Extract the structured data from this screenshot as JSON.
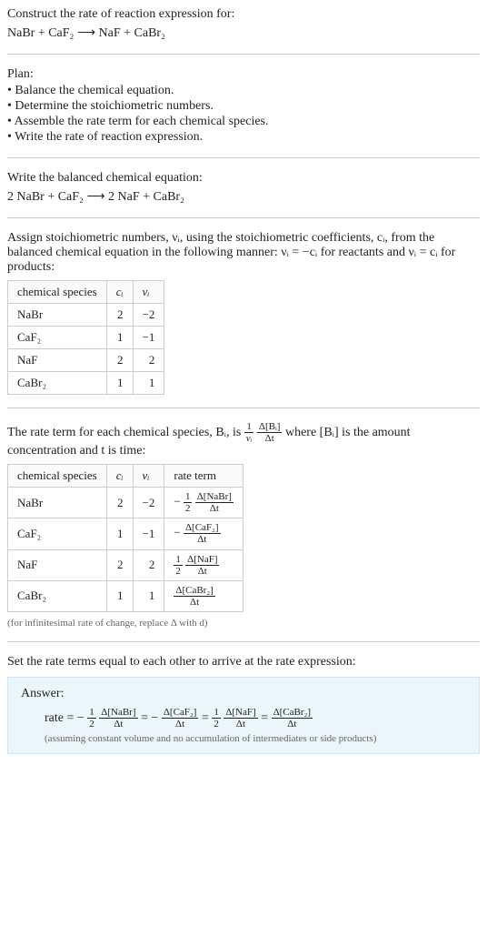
{
  "header": {
    "construct": "Construct the rate of reaction expression for:",
    "unbalanced": "NaBr + CaF₂ ⟶ NaF + CaBr₂"
  },
  "plan": {
    "title": "Plan:",
    "items": [
      "• Balance the chemical equation.",
      "• Determine the stoichiometric numbers.",
      "• Assemble the rate term for each chemical species.",
      "• Write the rate of reaction expression."
    ]
  },
  "balanced": {
    "text": "Write the balanced chemical equation:",
    "eq": "2 NaBr + CaF₂ ⟶ 2 NaF + CaBr₂"
  },
  "stoich_text": "Assign stoichiometric numbers, νᵢ, using the stoichiometric coefficients, cᵢ, from the balanced chemical equation in the following manner: νᵢ = −cᵢ for reactants and νᵢ = cᵢ for products:",
  "table1": {
    "headers": [
      "chemical species",
      "cᵢ",
      "νᵢ"
    ],
    "rows": [
      {
        "species": "NaBr",
        "c": "2",
        "v": "−2"
      },
      {
        "species": "CaF₂",
        "c": "1",
        "v": "−1"
      },
      {
        "species": "NaF",
        "c": "2",
        "v": "2"
      },
      {
        "species": "CaBr₂",
        "c": "1",
        "v": "1"
      }
    ]
  },
  "rate_term_text_1": "The rate term for each chemical species, Bᵢ, is ",
  "rate_term_text_2": " where [Bᵢ] is the amount concentration and t is time:",
  "rate_term_frac": {
    "num1": "1",
    "den1": "νᵢ",
    "num2": "Δ[Bᵢ]",
    "den2": "Δt"
  },
  "table2": {
    "headers": [
      "chemical species",
      "cᵢ",
      "νᵢ",
      "rate term"
    ],
    "rows": [
      {
        "species": "NaBr",
        "c": "2",
        "v": "−2",
        "rt": {
          "pre": "−",
          "f1n": "1",
          "f1d": "2",
          "f2n": "Δ[NaBr]",
          "f2d": "Δt"
        }
      },
      {
        "species": "CaF₂",
        "c": "1",
        "v": "−1",
        "rt": {
          "pre": "−",
          "f2n": "Δ[CaF₂]",
          "f2d": "Δt"
        }
      },
      {
        "species": "NaF",
        "c": "2",
        "v": "2",
        "rt": {
          "f1n": "1",
          "f1d": "2",
          "f2n": "Δ[NaF]",
          "f2d": "Δt"
        }
      },
      {
        "species": "CaBr₂",
        "c": "1",
        "v": "1",
        "rt": {
          "f2n": "Δ[CaBr₂]",
          "f2d": "Δt"
        }
      }
    ]
  },
  "footnote": "(for infinitesimal rate of change, replace Δ with d)",
  "set_equal": "Set the rate terms equal to each other to arrive at the rate expression:",
  "answer": {
    "label": "Answer:",
    "prefix": "rate = ",
    "terms": [
      {
        "pre": "−",
        "f1n": "1",
        "f1d": "2",
        "f2n": "Δ[NaBr]",
        "f2d": "Δt"
      },
      {
        "pre": "−",
        "f2n": "Δ[CaF₂]",
        "f2d": "Δt"
      },
      {
        "f1n": "1",
        "f1d": "2",
        "f2n": "Δ[NaF]",
        "f2d": "Δt"
      },
      {
        "f2n": "Δ[CaBr₂]",
        "f2d": "Δt"
      }
    ],
    "note": "(assuming constant volume and no accumulation of intermediates or side products)"
  }
}
